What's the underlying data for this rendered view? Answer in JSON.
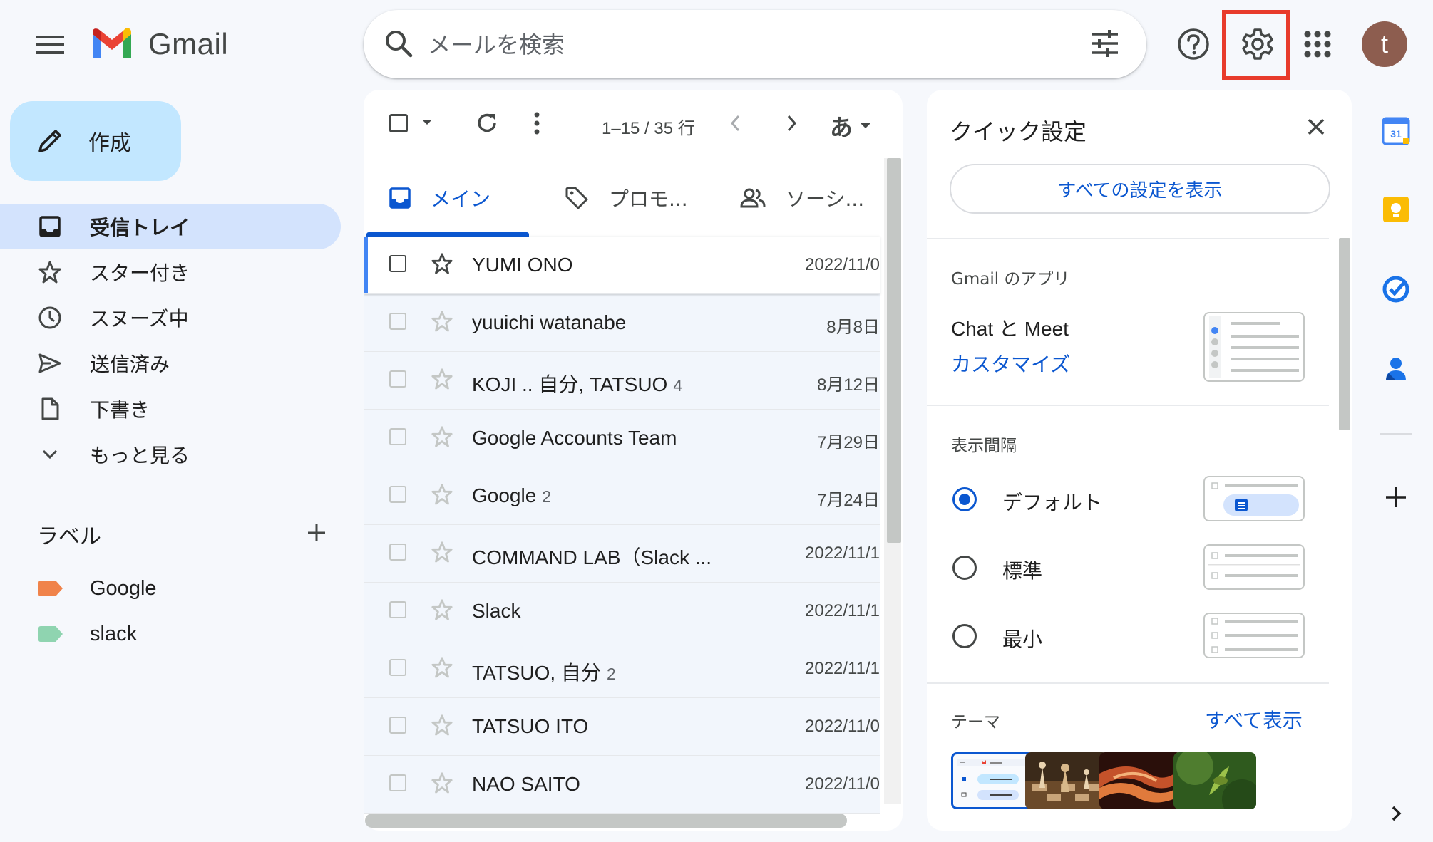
{
  "header": {
    "logo_text": "Gmail",
    "search_placeholder": "メールを検索",
    "avatar_letter": "t"
  },
  "compose": {
    "label": "作成"
  },
  "sidebar": {
    "items": [
      {
        "label": "受信トレイ",
        "icon": "inbox-icon",
        "active": true
      },
      {
        "label": "スター付き",
        "icon": "star-icon"
      },
      {
        "label": "スヌーズ中",
        "icon": "clock-icon"
      },
      {
        "label": "送信済み",
        "icon": "send-icon"
      },
      {
        "label": "下書き",
        "icon": "draft-icon"
      },
      {
        "label": "もっと見る",
        "icon": "chevron-down-icon"
      }
    ],
    "labels_heading": "ラベル",
    "labels": [
      {
        "name": "Google",
        "color": "#f0834a"
      },
      {
        "name": "slack",
        "color": "#8fd4b0"
      }
    ]
  },
  "toolbar": {
    "pager": "1–15 / 35 行",
    "input_tool": "あ"
  },
  "tabs": [
    {
      "label": "メイン",
      "icon": "inbox-icon",
      "active": true
    },
    {
      "label": "プロモ...",
      "icon": "tag-icon"
    },
    {
      "label": "ソーシ...",
      "icon": "people-icon"
    }
  ],
  "emails": [
    {
      "sender": "YUMI ONO",
      "count": "",
      "date": "2022/11/0",
      "selected": true
    },
    {
      "sender": "yuuichi watanabe",
      "count": "",
      "date": "8月8日"
    },
    {
      "sender": "KOJI .. 自分, TATSUO",
      "count": "4",
      "date": "8月12日"
    },
    {
      "sender": "Google Accounts Team",
      "count": "",
      "date": "7月29日"
    },
    {
      "sender": "Google",
      "count": "2",
      "date": "7月24日"
    },
    {
      "sender": "COMMAND LAB（Slack ...",
      "count": "",
      "date": "2022/11/1"
    },
    {
      "sender": "Slack",
      "count": "",
      "date": "2022/11/1"
    },
    {
      "sender": "TATSUO, 自分",
      "count": "2",
      "date": "2022/11/1"
    },
    {
      "sender": "TATSUO ITO",
      "count": "",
      "date": "2022/11/0"
    },
    {
      "sender": "NAO SAITO",
      "count": "",
      "date": "2022/11/0"
    }
  ],
  "quick_settings": {
    "title": "クイック設定",
    "all_settings": "すべての設定を表示",
    "apps_heading": "Gmail のアプリ",
    "chat_meet": "Chat と Meet",
    "customize": "カスタマイズ",
    "density_heading": "表示間隔",
    "density_options": [
      {
        "label": "デフォルト",
        "selected": true
      },
      {
        "label": "標準",
        "selected": false
      },
      {
        "label": "最小",
        "selected": false
      }
    ],
    "theme_heading": "テーマ",
    "theme_show_all": "すべて表示"
  },
  "colors": {
    "accent": "#0b57d0",
    "highlight_box": "#e83b2c",
    "compose_bg": "#c2e7ff",
    "active_nav_bg": "#d3e3fd"
  }
}
